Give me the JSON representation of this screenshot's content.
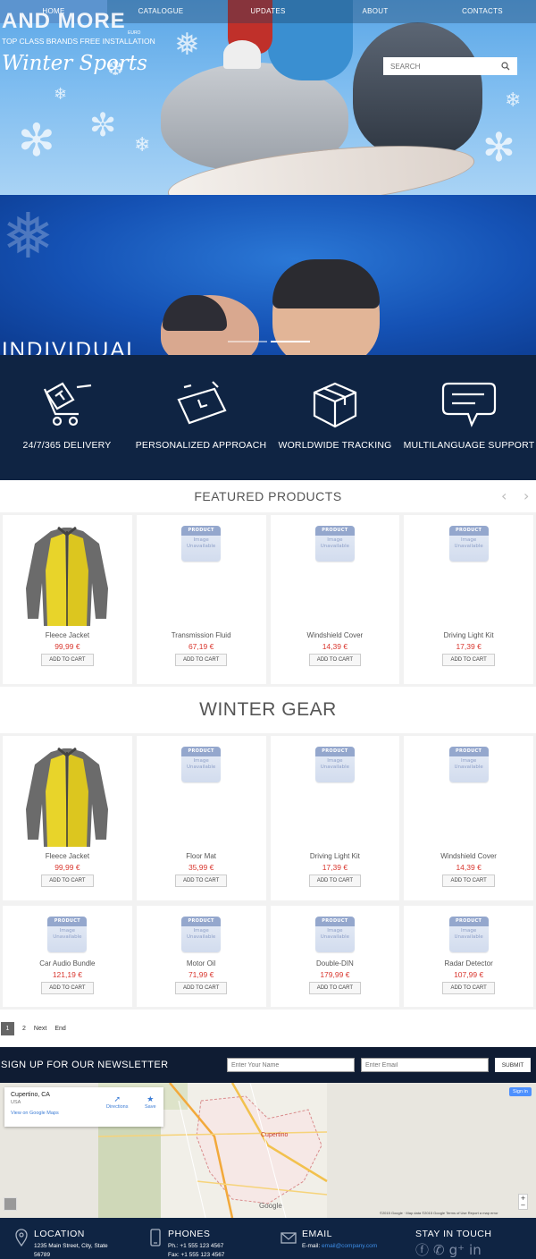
{
  "nav": {
    "items": [
      "HOME",
      "CATALOGUE",
      "UPDATES",
      "ABOUT",
      "CONTACTS"
    ],
    "active": 0
  },
  "hero": {
    "title": "AND MORE",
    "subtitle": "TOP CLASS BRANDS FREE INSTALLATION",
    "script": "Winter Sports",
    "euro": "EURO",
    "title2": "INDIVIDUAL",
    "search_placeholder": "SEARCH",
    "dots": 2,
    "active_dot": 1
  },
  "features": [
    {
      "icon": "delivery-cart-icon",
      "label": "24/7/365 DELIVERY"
    },
    {
      "icon": "alarm-clock-icon",
      "label": "PERSONALIZED APPROACH"
    },
    {
      "icon": "box-icon",
      "label": "WORLDWIDE TRACKING"
    },
    {
      "icon": "chat-bubble-icon",
      "label": "MULTILANGUAGE SUPPORT"
    }
  ],
  "featured": {
    "title": "FEATURED PRODUCTS",
    "prev": "‹",
    "next": "›",
    "products": [
      {
        "name": "Fleece Jacket",
        "price": "99,99 €",
        "image": "jacket"
      },
      {
        "name": "Transmission Fluid",
        "price": "67,19 €",
        "image": "unavailable"
      },
      {
        "name": "Windshield Cover",
        "price": "14,39 €",
        "image": "unavailable"
      },
      {
        "name": "Driving Light Kit",
        "price": "17,39 €",
        "image": "unavailable"
      }
    ]
  },
  "winter": {
    "title": "WINTER GEAR",
    "row1": [
      {
        "name": "Fleece Jacket",
        "price": "99,99 €",
        "image": "jacket"
      },
      {
        "name": "Floor Mat",
        "price": "35,99 €",
        "image": "unavailable"
      },
      {
        "name": "Driving Light Kit",
        "price": "17,39 €",
        "image": "unavailable"
      },
      {
        "name": "Windshield Cover",
        "price": "14,39 €",
        "image": "unavailable"
      }
    ],
    "row2": [
      {
        "name": "Car Audio Bundle",
        "price": "121,19 €",
        "image": "unavailable"
      },
      {
        "name": "Motor Oil",
        "price": "71,99 €",
        "image": "unavailable"
      },
      {
        "name": "Double-DIN",
        "price": "179,99 €",
        "image": "unavailable"
      },
      {
        "name": "Radar Detector",
        "price": "107,99 €",
        "image": "unavailable"
      }
    ]
  },
  "placeholder": {
    "top": "PRODUCT",
    "line1": "Image",
    "line2": "Unavailable"
  },
  "cart_label": "ADD TO CART",
  "pagination": {
    "current": "1",
    "next_page": "2",
    "next": "Next",
    "end": "End"
  },
  "newsletter": {
    "title": "SIGN UP FOR OUR NEWSLETTER",
    "name_placeholder": "Enter Your Name",
    "email_placeholder": "Enter Email",
    "button": "SUBMIT"
  },
  "map": {
    "place": "Cupertino, CA",
    "country": "USA",
    "link": "View on Google Maps",
    "directions": "Directions",
    "save": "Save",
    "signin": "Sign in",
    "city_label": "Cupertino",
    "google": "Google",
    "footer": "©2015 Google · Map data ©2015 Google    Terms of Use    Report a map error"
  },
  "footer": {
    "location": {
      "title": "LOCATION",
      "line1": "1235 Main Street, City, State",
      "line2": "56789"
    },
    "phones": {
      "title": "PHONES",
      "line1": "Ph.: +1 555 123 4567",
      "line2": "Fax: +1 555 123 4567"
    },
    "email": {
      "title": "EMAIL",
      "label": "E-mail:",
      "address": "email@company.com"
    },
    "social": {
      "title": "STAY IN TOUCH",
      "icons": [
        "facebook-icon",
        "twitter-icon",
        "google-plus-icon",
        "linkedin-icon"
      ]
    }
  },
  "colors": {
    "navy": "#0f2443",
    "price_red": "#d9372f",
    "link_blue": "#3d8ee8"
  }
}
